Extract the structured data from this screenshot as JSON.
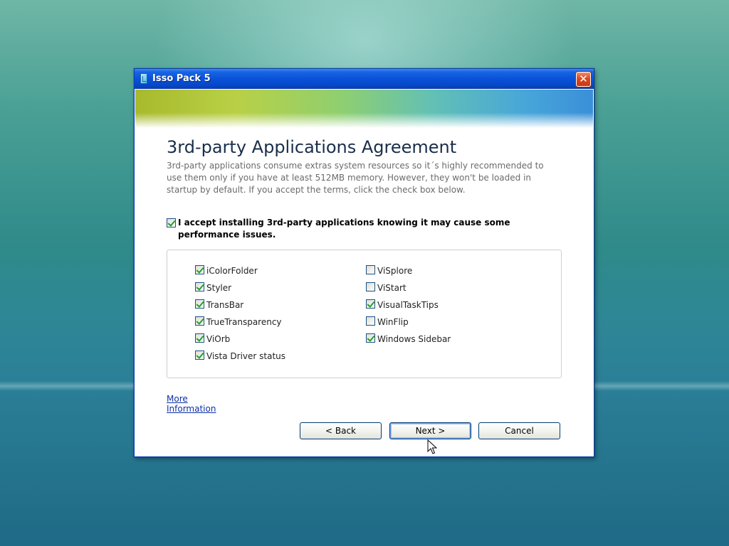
{
  "window": {
    "title": "Isso Pack 5",
    "close_glyph": "✕"
  },
  "page": {
    "heading": "3rd-party Applications Agreement",
    "description": "3rd-party applications consume extras system resources so it´s highly recommended to use them only if you have at least 512MB memory. However, they won't be loaded in startup by default. If you accept the terms, click the check box below.",
    "accept": {
      "checked": true,
      "label": "I accept installing 3rd-party applications knowing it may cause some performance issues."
    }
  },
  "applications": {
    "left": [
      {
        "label": "iColorFolder",
        "checked": true
      },
      {
        "label": "Styler",
        "checked": true
      },
      {
        "label": "TransBar",
        "checked": true
      },
      {
        "label": "TrueTransparency",
        "checked": true
      },
      {
        "label": "ViOrb",
        "checked": true
      },
      {
        "label": "Vista Driver status",
        "checked": true
      }
    ],
    "right": [
      {
        "label": "ViSplore",
        "checked": false
      },
      {
        "label": "ViStart",
        "checked": false
      },
      {
        "label": "VisualTaskTips",
        "checked": true
      },
      {
        "label": "WinFlip",
        "checked": false
      },
      {
        "label": "Windows Sidebar",
        "checked": true
      }
    ]
  },
  "links": {
    "more_info": "More Information"
  },
  "buttons": {
    "back": "< Back",
    "next": "Next >",
    "cancel": "Cancel"
  },
  "icons": {
    "app": "installer-app-icon",
    "close": "close-icon",
    "cursor": "mouse-pointer-icon"
  },
  "colors": {
    "titlebar": "#0a52d8",
    "close": "#dc4a22",
    "link": "#0b2fa6",
    "check": "#21a121"
  }
}
